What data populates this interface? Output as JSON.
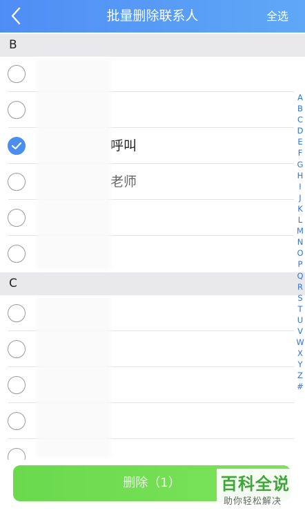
{
  "header": {
    "title": "批量删除联系人",
    "select_all": "全选"
  },
  "sections": [
    {
      "letter": "B",
      "rows": [
        {
          "name": "",
          "checked": false
        },
        {
          "name": "",
          "checked": false
        },
        {
          "name": "呼叫",
          "checked": true
        },
        {
          "name": "老师",
          "checked": false
        },
        {
          "name": "",
          "checked": false
        },
        {
          "name": "",
          "checked": false
        }
      ]
    },
    {
      "letter": "C",
      "rows": [
        {
          "name": "",
          "checked": false
        },
        {
          "name": "",
          "checked": false
        },
        {
          "name": "",
          "checked": false
        },
        {
          "name": "",
          "checked": false
        }
      ]
    }
  ],
  "index_letters": [
    "A",
    "B",
    "C",
    "D",
    "E",
    "F",
    "G",
    "H",
    "I",
    "J",
    "K",
    "L",
    "M",
    "N",
    "O",
    "P",
    "Q",
    "R",
    "S",
    "T",
    "U",
    "V",
    "W",
    "X",
    "Y",
    "Z",
    "#"
  ],
  "footer": {
    "delete_label": "删除（1）"
  },
  "watermark": {
    "main": "百科全说",
    "sub": "助你轻松解决"
  },
  "colors": {
    "header": "#4f8df5",
    "check": "#4b8ef0",
    "delete": "#6ad94e",
    "index": "#2f73e6"
  }
}
